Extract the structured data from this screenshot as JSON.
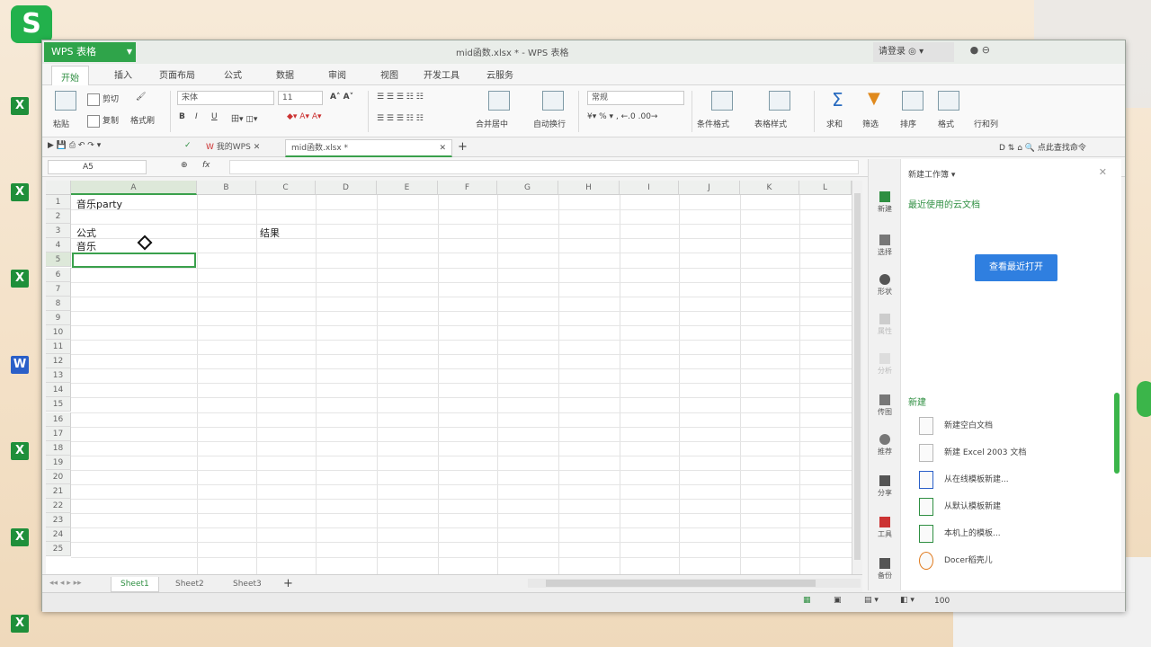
{
  "window": {
    "app_badge": "WPS 表格",
    "doc_title": "mid函数.xlsx * - WPS 表格",
    "user_name": "请登录"
  },
  "ribbon_tabs": [
    "开始",
    "插入",
    "页面布局",
    "公式",
    "数据",
    "审阅",
    "视图",
    "开发工具",
    "云服务"
  ],
  "active_tab": "开始",
  "ribbon": {
    "cut": "剪切",
    "copy": "复制",
    "paste": "粘贴",
    "format_painter": "格式刷",
    "font_name": "宋体",
    "font_size": "11",
    "bold": "B",
    "italic": "I",
    "underline": "U",
    "merge_center": "合并居中",
    "wrap_text": "自动换行",
    "number_format": "常规",
    "percent": "%",
    "cond_format": "条件格式",
    "table_style": "表格样式",
    "sum": "求和",
    "filter": "筛选",
    "sort": "排序",
    "format": "格式",
    "row_col": "行和列"
  },
  "qat": {
    "my_wps": "我的WPS",
    "doc_tab": "mid函数.xlsx *",
    "search": "点此查找命令"
  },
  "formula_bar": {
    "cell_ref": "A5",
    "fx": "fx",
    "value": ""
  },
  "grid": {
    "columns": [
      "A",
      "B",
      "C",
      "D",
      "E",
      "F",
      "G",
      "H",
      "I",
      "J",
      "K",
      "L"
    ],
    "rows": [
      "1",
      "2",
      "3",
      "4",
      "5",
      "6",
      "7",
      "8",
      "9",
      "10",
      "11",
      "12",
      "13",
      "14",
      "15",
      "16",
      "17",
      "18",
      "19",
      "20",
      "21",
      "22",
      "23",
      "24",
      "25"
    ],
    "cells": {
      "A1": "音乐party",
      "A3": "公式",
      "A4": "音乐",
      "C3": "结果"
    }
  },
  "sheets": [
    "Sheet1",
    "Sheet2",
    "Sheet3"
  ],
  "active_sheet": "Sheet1",
  "status": {
    "zoom": "100"
  },
  "sidebar": [
    "新建",
    "选择",
    "形状",
    "属性",
    "分析",
    "传图",
    "推荐",
    "分享",
    "工具",
    "备份"
  ],
  "pane": {
    "header": "新建工作簿",
    "recent_link": "最近使用的云文档",
    "open_button": "查看最近打开",
    "new_section": "新建",
    "items": [
      "新建空白文档",
      "新建 Excel 2003 文档",
      "从在线模板新建...",
      "从默认模板新建",
      "本机上的模板...",
      "Docer稻壳儿"
    ]
  },
  "desktop": {
    "logo": "S",
    "excel_letter": "X",
    "word_letter": "W"
  },
  "colors": {
    "accent": "#3aa04c",
    "wps_green": "#2fa44a",
    "blue_button": "#2f7fe0"
  }
}
